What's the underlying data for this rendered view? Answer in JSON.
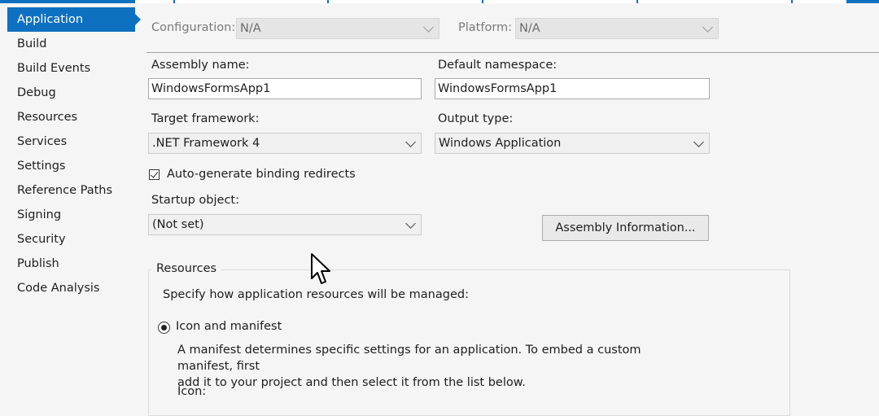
{
  "sidebar": {
    "items": [
      {
        "label": "Application",
        "active": true
      },
      {
        "label": "Build"
      },
      {
        "label": "Build Events"
      },
      {
        "label": "Debug"
      },
      {
        "label": "Resources"
      },
      {
        "label": "Services"
      },
      {
        "label": "Settings"
      },
      {
        "label": "Reference Paths"
      },
      {
        "label": "Signing"
      },
      {
        "label": "Security"
      },
      {
        "label": "Publish"
      },
      {
        "label": "Code Analysis"
      }
    ]
  },
  "config_bar": {
    "configuration_label": "Configuration:",
    "configuration_value": "N/A",
    "platform_label": "Platform:",
    "platform_value": "N/A"
  },
  "form": {
    "assembly_name_label": "Assembly name:",
    "assembly_name_value": "WindowsFormsApp1",
    "default_namespace_label": "Default namespace:",
    "default_namespace_value": "WindowsFormsApp1",
    "target_framework_label": "Target framework:",
    "target_framework_value": ".NET Framework 4",
    "output_type_label": "Output type:",
    "output_type_value": "Windows Application",
    "auto_binding_label": "Auto-generate binding redirects",
    "auto_binding_checked": true,
    "startup_object_label": "Startup object:",
    "startup_object_value": "(Not set)",
    "assembly_info_button": "Assembly Information..."
  },
  "resources": {
    "title": "Resources",
    "description": "Specify how application resources will be managed:",
    "icon_manifest_label": "Icon and manifest",
    "icon_manifest_selected": true,
    "manifest_help_line1": "A manifest determines specific settings for an application. To embed a custom manifest, first",
    "manifest_help_line2": "add it to your project and then select it from the list below.",
    "icon_label": "Icon:"
  },
  "colors": {
    "accent": "#0e70c0",
    "background": "#f5f5f5"
  }
}
